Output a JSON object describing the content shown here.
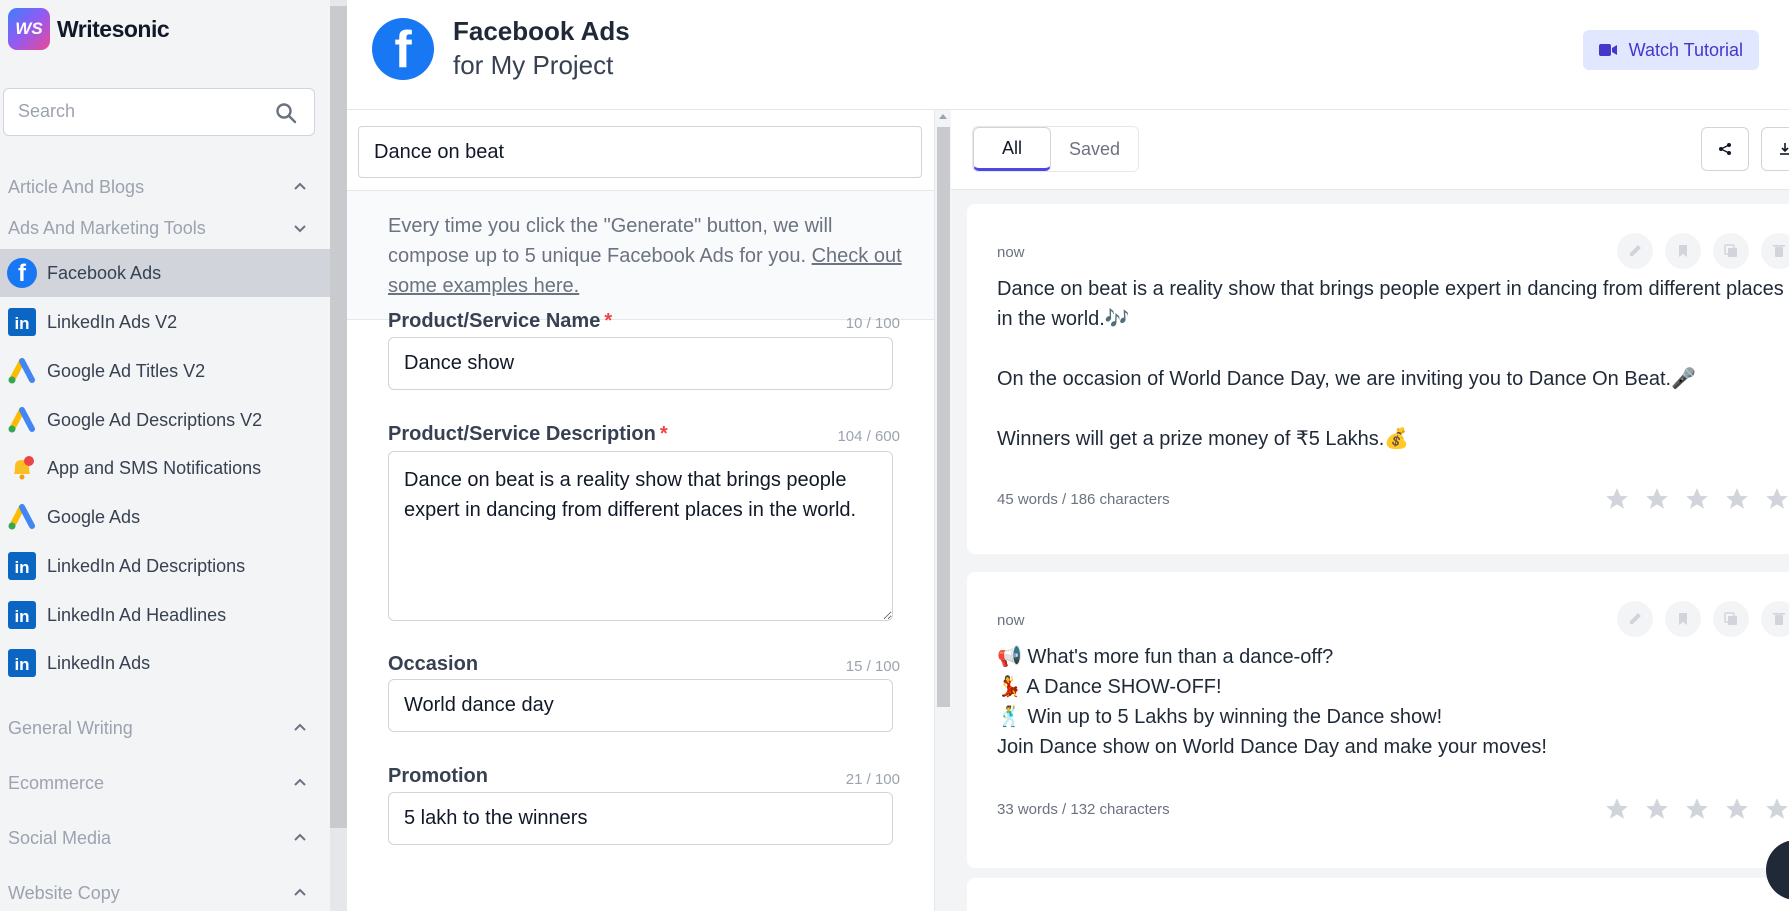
{
  "app": {
    "name": "Writesonic",
    "logo_mark": "WS"
  },
  "sidebar": {
    "search_placeholder": "Search",
    "categories": [
      {
        "label": "Article And Blogs",
        "chevron": "up"
      },
      {
        "label": "Ads And Marketing Tools",
        "chevron": "down"
      },
      {
        "label": "General Writing",
        "chevron": "up"
      },
      {
        "label": "Ecommerce",
        "chevron": "up"
      },
      {
        "label": "Social Media",
        "chevron": "up"
      },
      {
        "label": "Website Copy",
        "chevron": "up"
      }
    ],
    "items": [
      {
        "label": "Facebook Ads",
        "icon": "facebook-icon",
        "active": true
      },
      {
        "label": "LinkedIn Ads V2",
        "icon": "linkedin-icon"
      },
      {
        "label": "Google Ad Titles V2",
        "icon": "google-ads-icon"
      },
      {
        "label": "Google Ad Descriptions V2",
        "icon": "google-ads-icon"
      },
      {
        "label": "App and SMS Notifications",
        "icon": "bell-icon"
      },
      {
        "label": "Google Ads",
        "icon": "google-ads-icon"
      },
      {
        "label": "LinkedIn Ad Descriptions",
        "icon": "linkedin-icon"
      },
      {
        "label": "LinkedIn Ad Headlines",
        "icon": "linkedin-icon"
      },
      {
        "label": "LinkedIn Ads",
        "icon": "linkedin-icon"
      }
    ]
  },
  "header": {
    "title": "Facebook Ads",
    "subtitle": "for My Project",
    "tutorial_label": "Watch Tutorial"
  },
  "form": {
    "project_value": "Dance on beat",
    "info_text": "Every time you click the \"Generate\" button, we will compose up to 5 unique Facebook Ads for you. ",
    "info_link": "Check out some examples here.",
    "fields": [
      {
        "label": "Product/Service Name",
        "required": true,
        "count": "10 / 100",
        "value": "Dance show"
      },
      {
        "label": "Product/Service Description",
        "required": true,
        "count": "104 / 600",
        "value": "Dance on beat is a reality show that brings people expert in dancing from different places in the world."
      },
      {
        "label": "Occasion",
        "required": false,
        "count": "15 / 100",
        "value": "World dance day"
      },
      {
        "label": "Promotion",
        "required": false,
        "count": "21 / 100",
        "value": "5 lakh to the winners"
      }
    ],
    "required_mark": "*"
  },
  "results": {
    "tabs": [
      "All",
      "Saved"
    ],
    "cards": [
      {
        "time": "now",
        "lines": [
          "Dance on beat is a reality show that brings people expert in dancing from different places in the world.🎶",
          "",
          "On the occasion of World Dance Day, we are inviting you to Dance On Beat.🎤",
          "",
          "Winners will get a prize money of ₹5 Lakhs.💰"
        ],
        "meta": "45 words / 186 characters"
      },
      {
        "time": "now",
        "lines": [
          "📢 What's more fun than a dance-off?",
          "💃 A Dance SHOW-OFF!",
          "🕺 Win up to 5 Lakhs by winning the Dance show!",
          "Join Dance show on World Dance Day and make your moves!"
        ],
        "meta": "33 words / 132 characters"
      }
    ]
  },
  "colors": {
    "accent": "#4f46e5",
    "facebook": "#1877f2",
    "linkedin": "#0a66c2",
    "required": "#ef4444",
    "sidebar_bg": "#f3f4f6"
  }
}
